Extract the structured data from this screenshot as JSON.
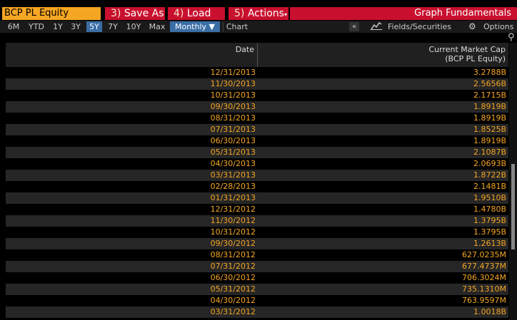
{
  "security": "BCP PL Equity",
  "buttons": {
    "save_num": "3)",
    "save_label": "Save As",
    "load_num": "4)",
    "load_label": "Load",
    "actions_num": "5)",
    "actions_label": "Actions"
  },
  "title": "Graph Fundamentals",
  "periods": [
    "6M",
    "YTD",
    "1Y",
    "3Y",
    "5Y",
    "7Y",
    "10Y",
    "Max"
  ],
  "active_period": "5Y",
  "frequency": "Monthly",
  "chart_label": "Chart",
  "collapse": "«",
  "fields_label": "Fields/Securities",
  "options_label": "Options",
  "table": {
    "date_header": "Date",
    "value_header_line1": "Current Market Cap",
    "value_header_line2": "(BCP PL Equity)",
    "rows": [
      {
        "date": "12/31/2013",
        "value": "3.2788B"
      },
      {
        "date": "11/30/2013",
        "value": "2.5656B"
      },
      {
        "date": "10/31/2013",
        "value": "2.1715B"
      },
      {
        "date": "09/30/2013",
        "value": "1.8919B"
      },
      {
        "date": "08/31/2013",
        "value": "1.8919B"
      },
      {
        "date": "07/31/2013",
        "value": "1.8525B"
      },
      {
        "date": "06/30/2013",
        "value": "1.8919B"
      },
      {
        "date": "05/31/2013",
        "value": "2.1087B"
      },
      {
        "date": "04/30/2013",
        "value": "2.0693B"
      },
      {
        "date": "03/31/2013",
        "value": "1.8722B"
      },
      {
        "date": "02/28/2013",
        "value": "2.1481B"
      },
      {
        "date": "01/31/2013",
        "value": "1.9510B"
      },
      {
        "date": "12/31/2012",
        "value": "1.4780B"
      },
      {
        "date": "11/30/2012",
        "value": "1.3795B"
      },
      {
        "date": "10/31/2012",
        "value": "1.3795B"
      },
      {
        "date": "09/30/2012",
        "value": "1.2613B"
      },
      {
        "date": "08/31/2012",
        "value": "627.0235M"
      },
      {
        "date": "07/31/2012",
        "value": "677.4737M"
      },
      {
        "date": "06/30/2012",
        "value": "706.3024M"
      },
      {
        "date": "05/31/2012",
        "value": "735.1310M"
      },
      {
        "date": "04/30/2012",
        "value": "763.9597M"
      },
      {
        "date": "03/31/2012",
        "value": "1.0018B"
      }
    ]
  }
}
